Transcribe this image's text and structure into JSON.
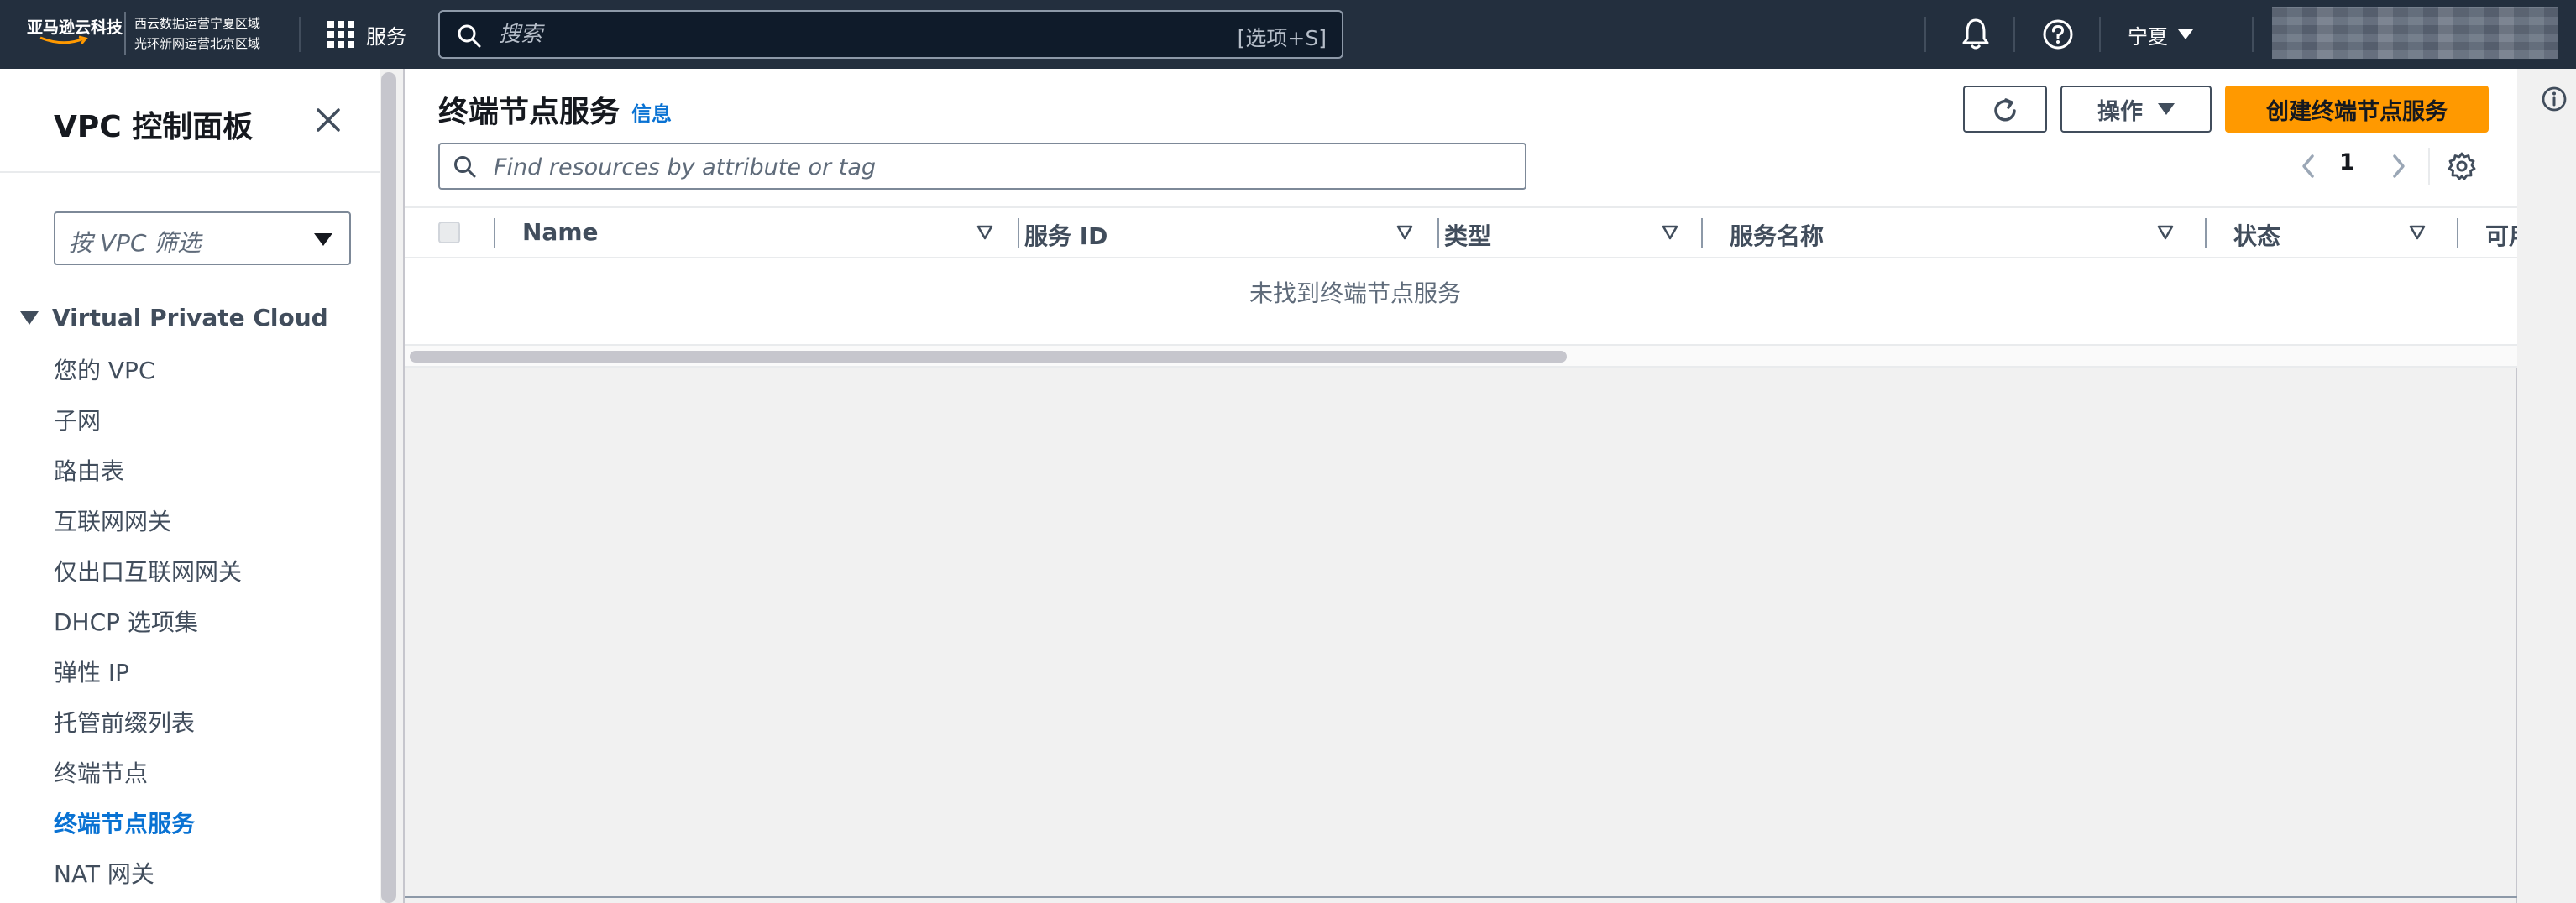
{
  "topnav": {
    "logo_text": "亚马逊云科技",
    "region_line1": "西云数据运营宁夏区域",
    "region_line2": "光环新网运营北京区域",
    "services_label": "服务",
    "search_placeholder": "搜索",
    "search_shortcut": "[选项+S]",
    "region_selector": "宁夏",
    "colors": {
      "bg": "#232f3e",
      "search_bg": "#0f1b2a"
    }
  },
  "sidebar": {
    "title": "VPC 控制面板",
    "vpc_filter_placeholder": "按 VPC 筛选",
    "section_label": "Virtual Private Cloud",
    "items": [
      {
        "label": "您的 VPC"
      },
      {
        "label": "子网"
      },
      {
        "label": "路由表"
      },
      {
        "label": "互联网网关"
      },
      {
        "label": "仅出口互联网网关"
      },
      {
        "label": "DHCP 选项集"
      },
      {
        "label": "弹性 IP"
      },
      {
        "label": "托管前缀列表"
      },
      {
        "label": "终端节点"
      },
      {
        "label": "终端节点服务",
        "active": true
      },
      {
        "label": "NAT 网关"
      }
    ]
  },
  "main": {
    "title": "终端节点服务",
    "info_link": "信息",
    "actions_label": "操作",
    "create_label": "创建终端节点服务",
    "filter_placeholder": "Find resources by attribute or tag",
    "pagination": {
      "current_page": "1"
    },
    "table": {
      "columns": [
        "Name",
        "服务 ID",
        "类型",
        "服务名称",
        "状态",
        "可用"
      ],
      "empty_message": "未找到终端节点服务"
    },
    "colors": {
      "primary": "#ff9900",
      "link": "#0972d3"
    }
  }
}
